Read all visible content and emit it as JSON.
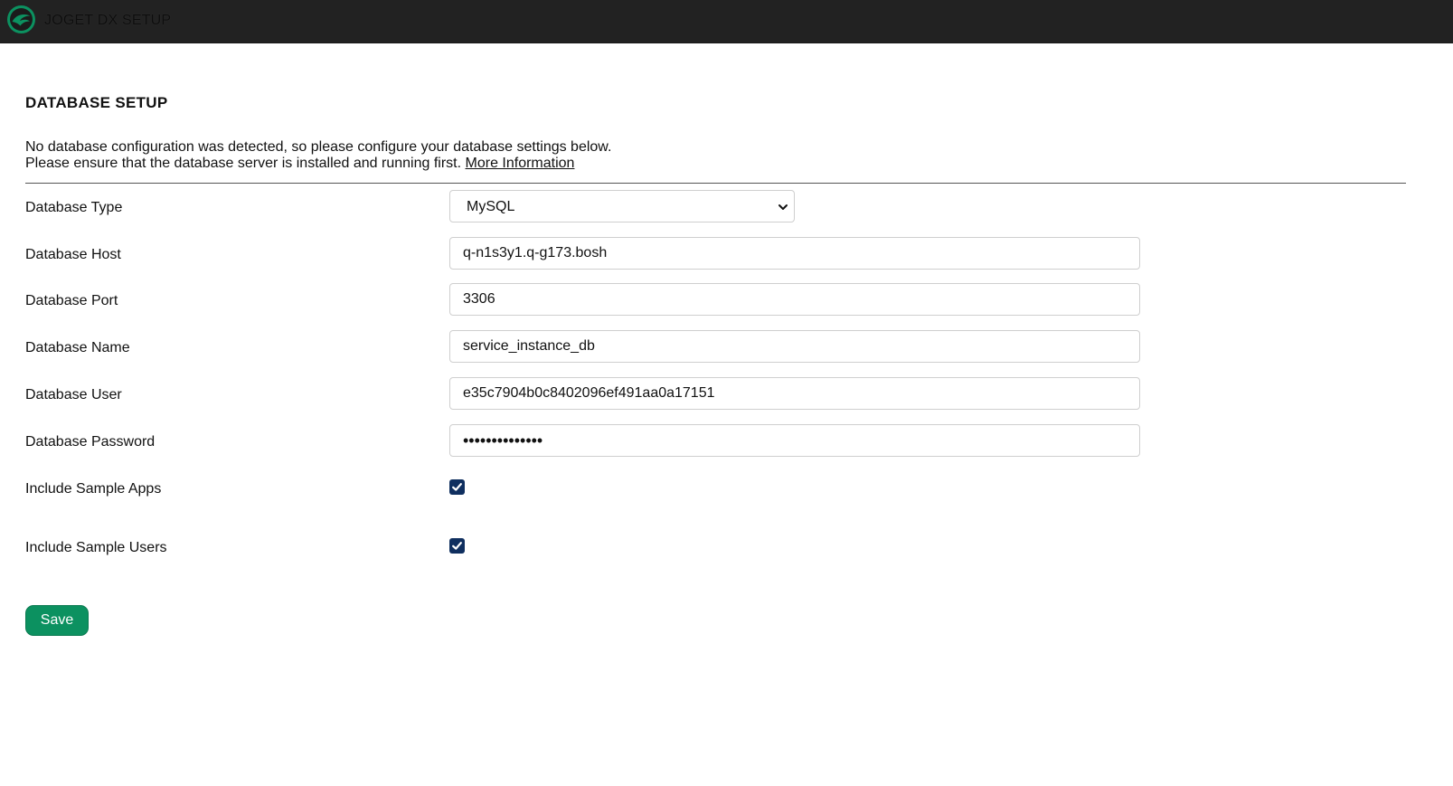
{
  "header": {
    "title": "JOGET DX SETUP",
    "logo_icon": "joget-logo-icon",
    "accent_color": "#0c9160",
    "bar_color": "#222222"
  },
  "main": {
    "title": "DATABASE SETUP",
    "intro_line1": "No database configuration was detected, so please configure your database settings below.",
    "intro_line2": "Please ensure that the database server is installed and running first.",
    "more_info_link": "More Information"
  },
  "form": {
    "database_type": {
      "label": "Database Type",
      "value": "MySQL",
      "icon": "chevron-down-icon"
    },
    "database_host": {
      "label": "Database Host",
      "value": "q-n1s3y1.q-g173.bosh"
    },
    "database_port": {
      "label": "Database Port",
      "value": "3306"
    },
    "database_name": {
      "label": "Database Name",
      "value": "service_instance_db"
    },
    "database_user": {
      "label": "Database User",
      "value": "e35c7904b0c8402096ef491aa0a17151"
    },
    "database_password": {
      "label": "Database Password",
      "value": "••••••••••••••"
    },
    "include_sample_apps": {
      "label": "Include Sample Apps",
      "checked": true
    },
    "include_sample_users": {
      "label": "Include Sample Users",
      "checked": true
    },
    "save_label": "Save"
  }
}
